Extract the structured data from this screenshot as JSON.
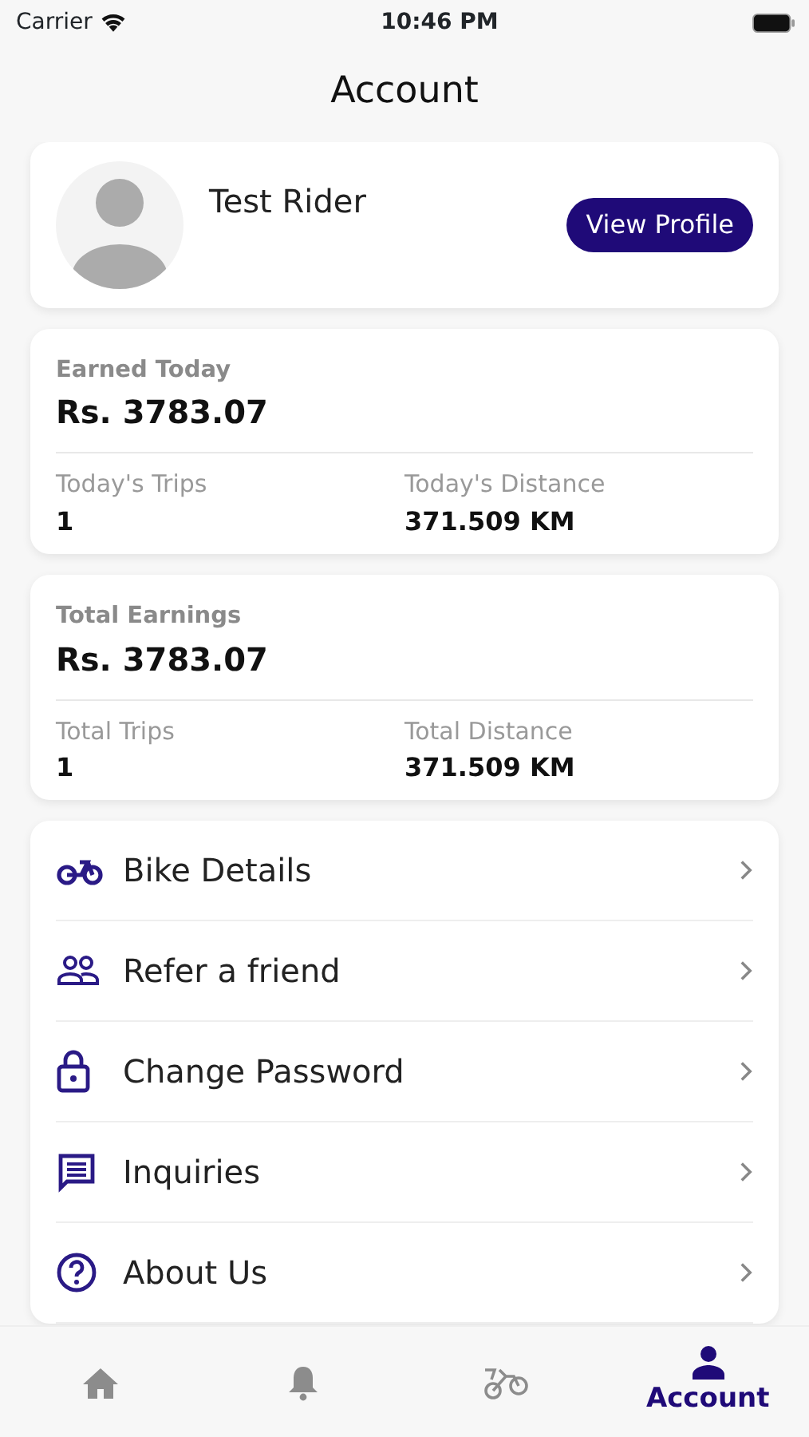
{
  "status_bar": {
    "carrier": "Carrier",
    "time": "10:46 PM"
  },
  "title": "Account",
  "profile": {
    "name": "Test Rider",
    "button": "View Profile"
  },
  "stat_cards": [
    {
      "heading": "Earned Today",
      "amount": "Rs. 3783.07",
      "stats": [
        {
          "label": "Today's Trips",
          "value": "1"
        },
        {
          "label": "Today's Distance",
          "value": "371.509 KM"
        }
      ]
    },
    {
      "heading": "Total Earnings",
      "amount": "Rs. 3783.07",
      "stats": [
        {
          "label": "Total Trips",
          "value": "1"
        },
        {
          "label": "Total Distance",
          "value": "371.509 KM"
        }
      ]
    }
  ],
  "menu": [
    {
      "kind": "bike",
      "label": "Bike Details"
    },
    {
      "kind": "people",
      "label": "Refer a friend"
    },
    {
      "kind": "lock",
      "label": "Change Password"
    },
    {
      "kind": "chat",
      "label": "Inquiries"
    },
    {
      "kind": "help",
      "label": "About Us"
    }
  ],
  "tab_bar": [
    {
      "kind": "home",
      "selected": false
    },
    {
      "kind": "bell",
      "selected": false
    },
    {
      "kind": "bike",
      "selected": false
    },
    {
      "kind": "person",
      "label": "Account",
      "selected": true
    }
  ]
}
